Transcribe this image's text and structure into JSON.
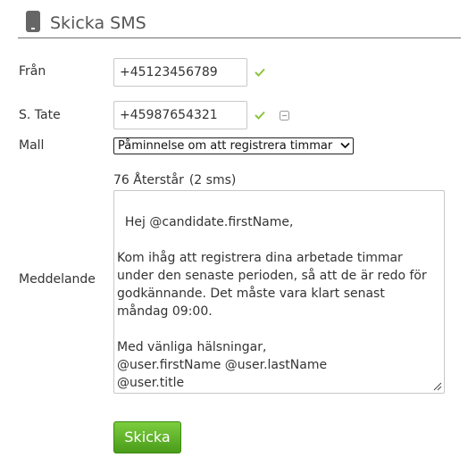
{
  "header": {
    "title": "Skicka SMS",
    "icon": "mobile-phone-icon"
  },
  "form": {
    "from": {
      "label": "Från",
      "value": "+45123456789"
    },
    "to": {
      "label": "S. Tate",
      "value": "+45987654321"
    },
    "template": {
      "label": "Mall",
      "selected": "Påminnelse om att registrera timmar"
    },
    "message": {
      "label": "Meddelande",
      "remaining": "76 Återstår",
      "sms_count": "(2 sms)",
      "text": "Hej @candidate.firstName,\n\nKom ihåg att registrera dina arbetade timmar under den senaste perioden, så att de är redo för godkännande. Det måste vara klart senast måndag 09:00.\n\nMed vänliga hälsningar,\n@user.firstName @user.lastName\n@user.title"
    },
    "send_label": "Skicka"
  },
  "colors": {
    "valid_check": "#8cc63f",
    "send_button": "#5aad24",
    "header_icon": "#555555"
  }
}
